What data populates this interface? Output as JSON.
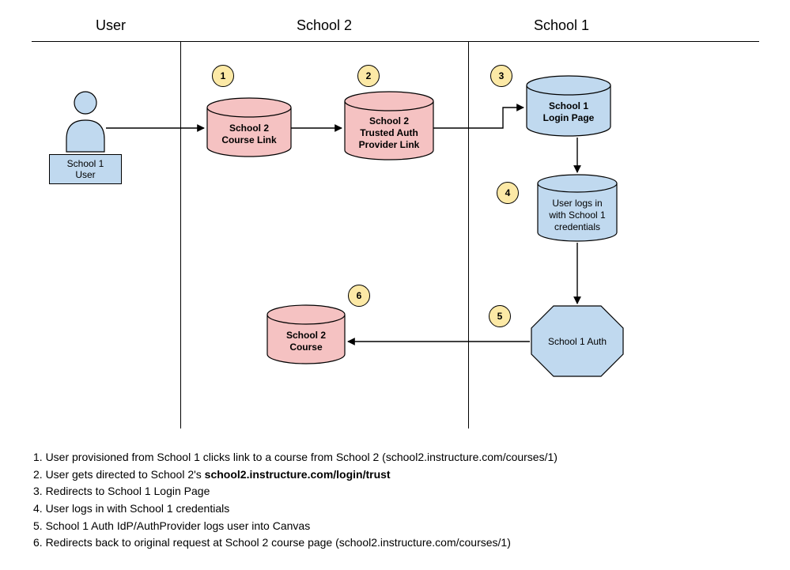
{
  "lanes": {
    "user": "User",
    "school2": "School 2",
    "school1": "School 1"
  },
  "nodes": {
    "userLabel": "School 1 User",
    "courseLink": "School 2\nCourse Link",
    "authProviderLink": "School 2\nTrusted Auth\nProvider Link",
    "loginPage": "School 1\nLogin Page",
    "credentials": "User logs in\nwith School 1\ncredentials",
    "auth": "School 1 Auth",
    "course": "School 2\nCourse"
  },
  "steps": {
    "s1": "1",
    "s2": "2",
    "s3": "3",
    "s4": "4",
    "s5": "5",
    "s6": "6"
  },
  "notes": {
    "n1_pre": "1. User provisioned from School 1 clicks link to a course from School 2 (school2.instructure.com/courses/1)",
    "n2_pre": "2. User gets directed to School 2's ",
    "n2_bold": "school2.instructure.com/login/trust",
    "n3": "3. Redirects to School 1 Login Page",
    "n4": "4. User logs in with School 1 credentials",
    "n5": "5. School 1 Auth IdP/AuthProvider logs user into Canvas",
    "n6": "6. Redirects back to original request at School 2 course page (school2.instructure.com/courses/1)"
  },
  "colors": {
    "blueFill": "#c0d9ef",
    "pinkFill": "#f5c2c2",
    "yellowFill": "#fce9a6",
    "stroke": "#000000"
  }
}
